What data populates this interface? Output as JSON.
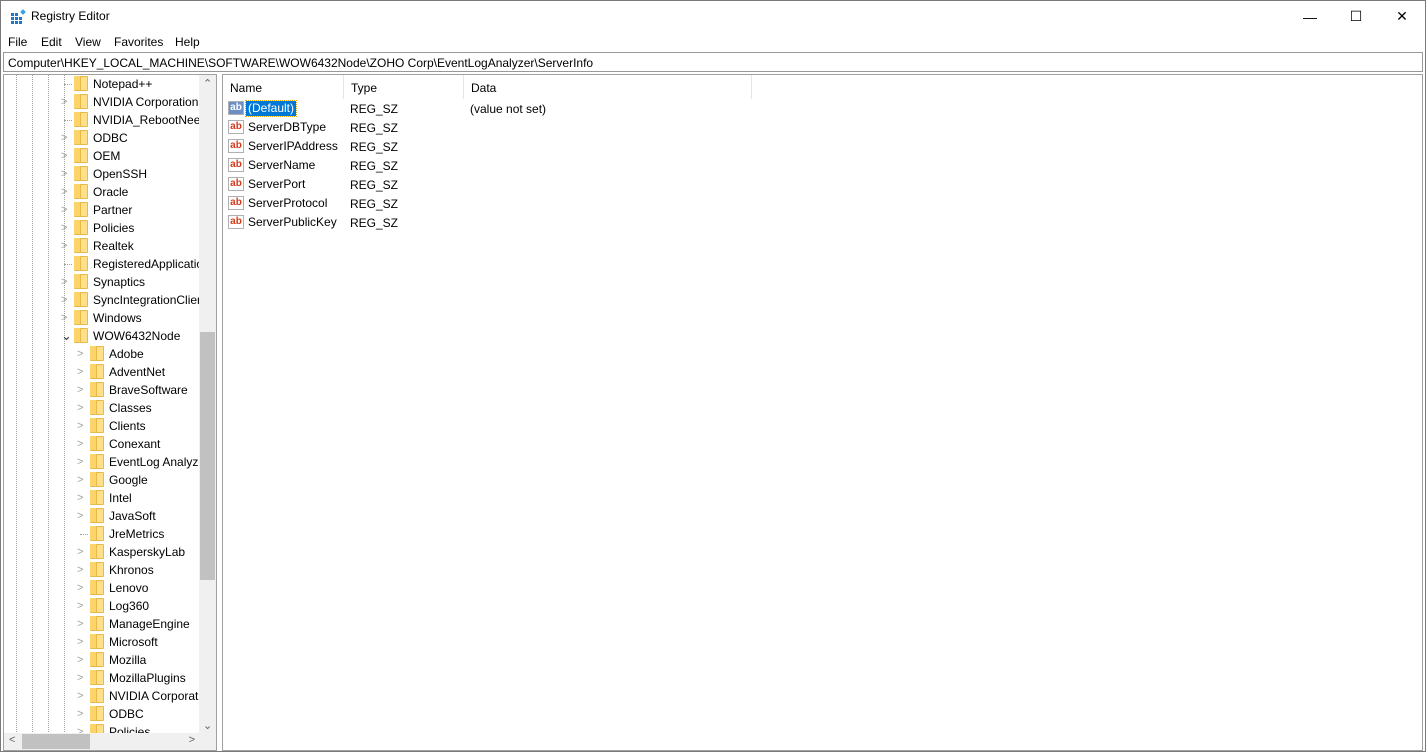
{
  "window": {
    "title": "Registry Editor",
    "minimize": "—",
    "maximize": "☐",
    "close": "✕"
  },
  "menu": [
    "File",
    "Edit",
    "View",
    "Favorites",
    "Help"
  ],
  "address": "Computer\\HKEY_LOCAL_MACHINE\\SOFTWARE\\WOW6432Node\\ZOHO Corp\\EventLogAnalyzer\\ServerInfo",
  "tree": [
    {
      "label": "Notepad++",
      "level": 1,
      "expander": "none"
    },
    {
      "label": "NVIDIA Corporation",
      "level": 1,
      "expander": "collapsed"
    },
    {
      "label": "NVIDIA_RebootNeeded",
      "level": 1,
      "expander": "none"
    },
    {
      "label": "ODBC",
      "level": 1,
      "expander": "collapsed"
    },
    {
      "label": "OEM",
      "level": 1,
      "expander": "collapsed"
    },
    {
      "label": "OpenSSH",
      "level": 1,
      "expander": "collapsed"
    },
    {
      "label": "Oracle",
      "level": 1,
      "expander": "collapsed"
    },
    {
      "label": "Partner",
      "level": 1,
      "expander": "collapsed"
    },
    {
      "label": "Policies",
      "level": 1,
      "expander": "collapsed"
    },
    {
      "label": "Realtek",
      "level": 1,
      "expander": "collapsed"
    },
    {
      "label": "RegisteredApplications",
      "level": 1,
      "expander": "none"
    },
    {
      "label": "Synaptics",
      "level": 1,
      "expander": "collapsed"
    },
    {
      "label": "SyncIntegrationClients",
      "level": 1,
      "expander": "collapsed"
    },
    {
      "label": "Windows",
      "level": 1,
      "expander": "collapsed"
    },
    {
      "label": "WOW6432Node",
      "level": 1,
      "expander": "expanded"
    },
    {
      "label": "Adobe",
      "level": 2,
      "expander": "collapsed"
    },
    {
      "label": "AdventNet",
      "level": 2,
      "expander": "collapsed"
    },
    {
      "label": "BraveSoftware",
      "level": 2,
      "expander": "collapsed"
    },
    {
      "label": "Classes",
      "level": 2,
      "expander": "collapsed"
    },
    {
      "label": "Clients",
      "level": 2,
      "expander": "collapsed"
    },
    {
      "label": "Conexant",
      "level": 2,
      "expander": "collapsed"
    },
    {
      "label": "EventLog Analyzer",
      "level": 2,
      "expander": "collapsed"
    },
    {
      "label": "Google",
      "level": 2,
      "expander": "collapsed"
    },
    {
      "label": "Intel",
      "level": 2,
      "expander": "collapsed"
    },
    {
      "label": "JavaSoft",
      "level": 2,
      "expander": "collapsed"
    },
    {
      "label": "JreMetrics",
      "level": 2,
      "expander": "none"
    },
    {
      "label": "KasperskyLab",
      "level": 2,
      "expander": "collapsed"
    },
    {
      "label": "Khronos",
      "level": 2,
      "expander": "collapsed"
    },
    {
      "label": "Lenovo",
      "level": 2,
      "expander": "collapsed"
    },
    {
      "label": "Log360",
      "level": 2,
      "expander": "collapsed"
    },
    {
      "label": "ManageEngine",
      "level": 2,
      "expander": "collapsed"
    },
    {
      "label": "Microsoft",
      "level": 2,
      "expander": "collapsed"
    },
    {
      "label": "Mozilla",
      "level": 2,
      "expander": "collapsed"
    },
    {
      "label": "MozillaPlugins",
      "level": 2,
      "expander": "collapsed"
    },
    {
      "label": "NVIDIA Corporation",
      "level": 2,
      "expander": "collapsed"
    },
    {
      "label": "ODBC",
      "level": 2,
      "expander": "collapsed"
    },
    {
      "label": "Policies",
      "level": 2,
      "expander": "collapsed"
    }
  ],
  "columns": [
    "Name",
    "Type",
    "Data"
  ],
  "values": [
    {
      "name": "(Default)",
      "type": "REG_SZ",
      "data": "(value not set)",
      "selected": true
    },
    {
      "name": "ServerDBType",
      "type": "REG_SZ",
      "data": ""
    },
    {
      "name": "ServerIPAddress",
      "type": "REG_SZ",
      "data": ""
    },
    {
      "name": "ServerName",
      "type": "REG_SZ",
      "data": ""
    },
    {
      "name": "ServerPort",
      "type": "REG_SZ",
      "data": ""
    },
    {
      "name": "ServerProtocol",
      "type": "REG_SZ",
      "data": ""
    },
    {
      "name": "ServerPublicKey",
      "type": "REG_SZ",
      "data": ""
    }
  ],
  "value_icon": "ab",
  "colors": {
    "selection": "#0078d7",
    "folder": "#ffe08a"
  }
}
